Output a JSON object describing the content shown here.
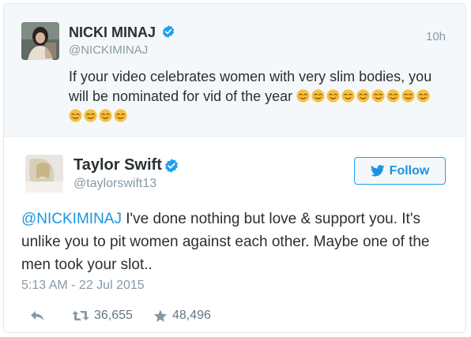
{
  "quoted_tweet": {
    "name": "NICKI MINAJ",
    "handle": "@NICKIMINAJ",
    "time": "10h",
    "text_line1": "If your video celebrates women with very slim bodies, you",
    "text_line2": "will be nominated for vid of the year",
    "emoji_icon": "smiling-face-emoji",
    "emoji_inline_count": 9,
    "emoji_next_line_count": 4
  },
  "tweet": {
    "name": "Taylor Swift",
    "handle": "@taylorswift13",
    "follow_label": "Follow",
    "mention": "@NICKIMINAJ",
    "text": " I've done nothing but love & support you. It's unlike you to pit women against each other. Maybe one of the men took your slot..",
    "timestamp": "5:13 AM - 22 Jul 2015",
    "retweets": "36,655",
    "favorites": "48,496"
  },
  "colors": {
    "accent": "#1da1f2",
    "link": "#1b95e0",
    "muted": "#8899a6",
    "text": "#292f33",
    "quoted_bg": "#f5f8fa",
    "emoji": "#f7c23a"
  },
  "icons": [
    "verified-badge-icon",
    "bird-icon",
    "reply-icon",
    "retweet-icon",
    "star-icon"
  ]
}
